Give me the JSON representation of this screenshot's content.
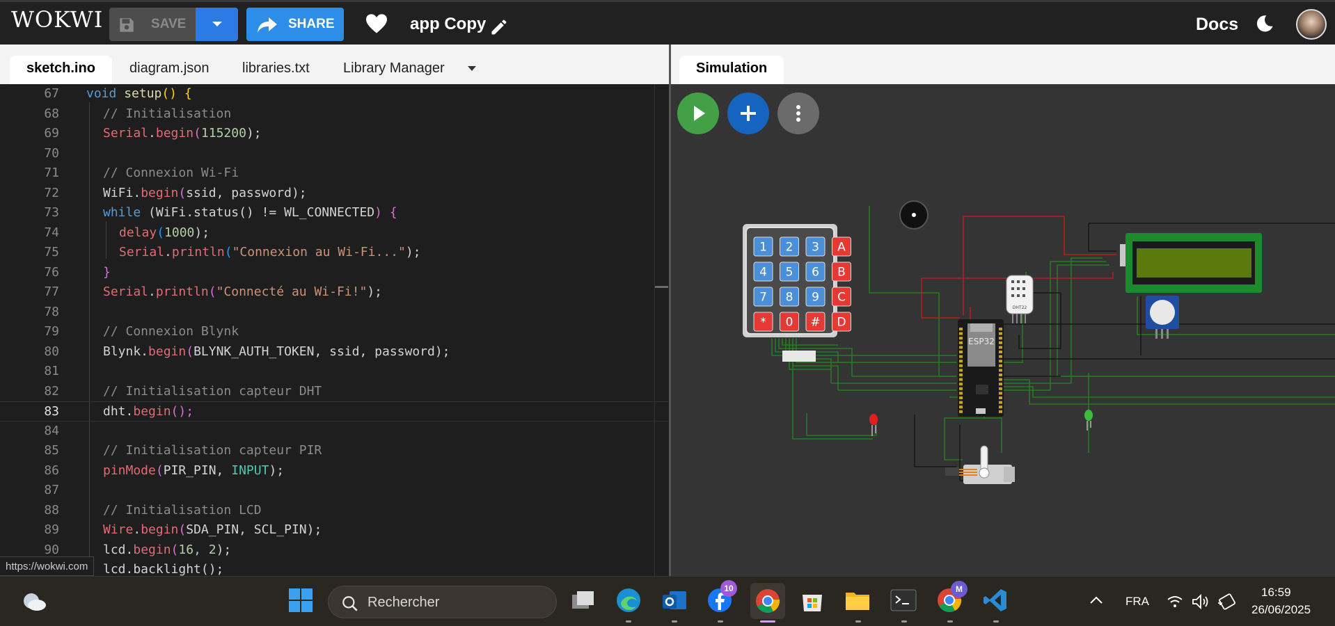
{
  "app": {
    "logo": "WOKWI",
    "save_label": "SAVE",
    "share_label": "SHARE",
    "project_name": "app Copy",
    "docs_label": "Docs"
  },
  "editor": {
    "tabs": [
      "sketch.ino",
      "diagram.json",
      "libraries.txt",
      "Library Manager"
    ],
    "active_tab": "sketch.ino",
    "current_line": 83,
    "lines": [
      {
        "n": "67"
      },
      {
        "n": "68"
      },
      {
        "n": "69"
      },
      {
        "n": "70"
      },
      {
        "n": "71"
      },
      {
        "n": "72"
      },
      {
        "n": "73"
      },
      {
        "n": "74"
      },
      {
        "n": "75"
      },
      {
        "n": "76"
      },
      {
        "n": "77"
      },
      {
        "n": "78"
      },
      {
        "n": "79"
      },
      {
        "n": "80"
      },
      {
        "n": "81"
      },
      {
        "n": "82"
      },
      {
        "n": "83"
      },
      {
        "n": "84"
      },
      {
        "n": "85"
      },
      {
        "n": "86"
      },
      {
        "n": "87"
      },
      {
        "n": "88"
      },
      {
        "n": "89"
      },
      {
        "n": "90"
      }
    ],
    "code": {
      "l67_kw": "void",
      "l67_fn": "setup",
      "l67_rest": "() {",
      "l68": "// Initialisation",
      "l69_obj": "Serial",
      "l69_m": "begin",
      "l69_num": "115200",
      "l69_end": ");",
      "l71": "// Connexion Wi-Fi",
      "l72_obj": "WiFi.",
      "l72_m": "begin",
      "l72_args": "ssid, password",
      "l72_end": ");",
      "l73_kw": "while",
      "l73_a": "(WiFi.status",
      "l73_b": "() != WL_CONNECTED",
      "l74_m": "delay",
      "l74_num": "1000",
      "l74_end": ");",
      "l75_obj": "Serial",
      "l75_m": "println",
      "l75_str": "\"Connexion au Wi-Fi...\"",
      "l75_end": ");",
      "l76": "}",
      "l77_obj": "Serial",
      "l77_m": "println",
      "l77_str": "\"Connecté au Wi-Fi!\"",
      "l77_end": ");",
      "l79": "// Connexion Blynk",
      "l80_obj": "Blynk.",
      "l80_m": "begin",
      "l80_args": "BLYNK_AUTH_TOKEN, ssid, password",
      "l80_end": ");",
      "l82": "// Initialisation capteur DHT",
      "l83_a": "dht.",
      "l83_m": "begin",
      "l83_end": "();",
      "l85": "// Initialisation capteur PIR",
      "l86_m": "pinMode",
      "l86_a": "PIR_PIN, ",
      "l86_c": "INPUT",
      "l86_end": ");",
      "l88": "// Initialisation LCD",
      "l89_obj": "Wire",
      "l89_m": "begin",
      "l89_args": "SDA_PIN, SCL_PIN",
      "l89_end": ");",
      "l90_a": "lcd.",
      "l90_m": "begin",
      "l90_num": "16, 2",
      "l90_end": ");",
      "l91": "lcd.backlight();"
    },
    "status_url": "https://wokwi.com"
  },
  "simulation": {
    "tab_label": "Simulation",
    "keypad_keys": [
      "1",
      "2",
      "3",
      "A",
      "4",
      "5",
      "6",
      "B",
      "7",
      "8",
      "9",
      "C",
      "*",
      "0",
      "#",
      "D"
    ],
    "esp_label": "ESP32",
    "dht_label": "DHT22"
  },
  "taskbar": {
    "search_placeholder": "Rechercher",
    "facebook_badge": "10",
    "chrome_profile_badge": "M",
    "language": "FRA",
    "time": "16:59",
    "date": "26/06/2025"
  },
  "colors": {
    "accent_blue": "#2c7be5",
    "run_green": "#43a047",
    "add_blue": "#1565c0",
    "wire_green": "#1f8a1f",
    "wire_red": "#d11a1a"
  }
}
